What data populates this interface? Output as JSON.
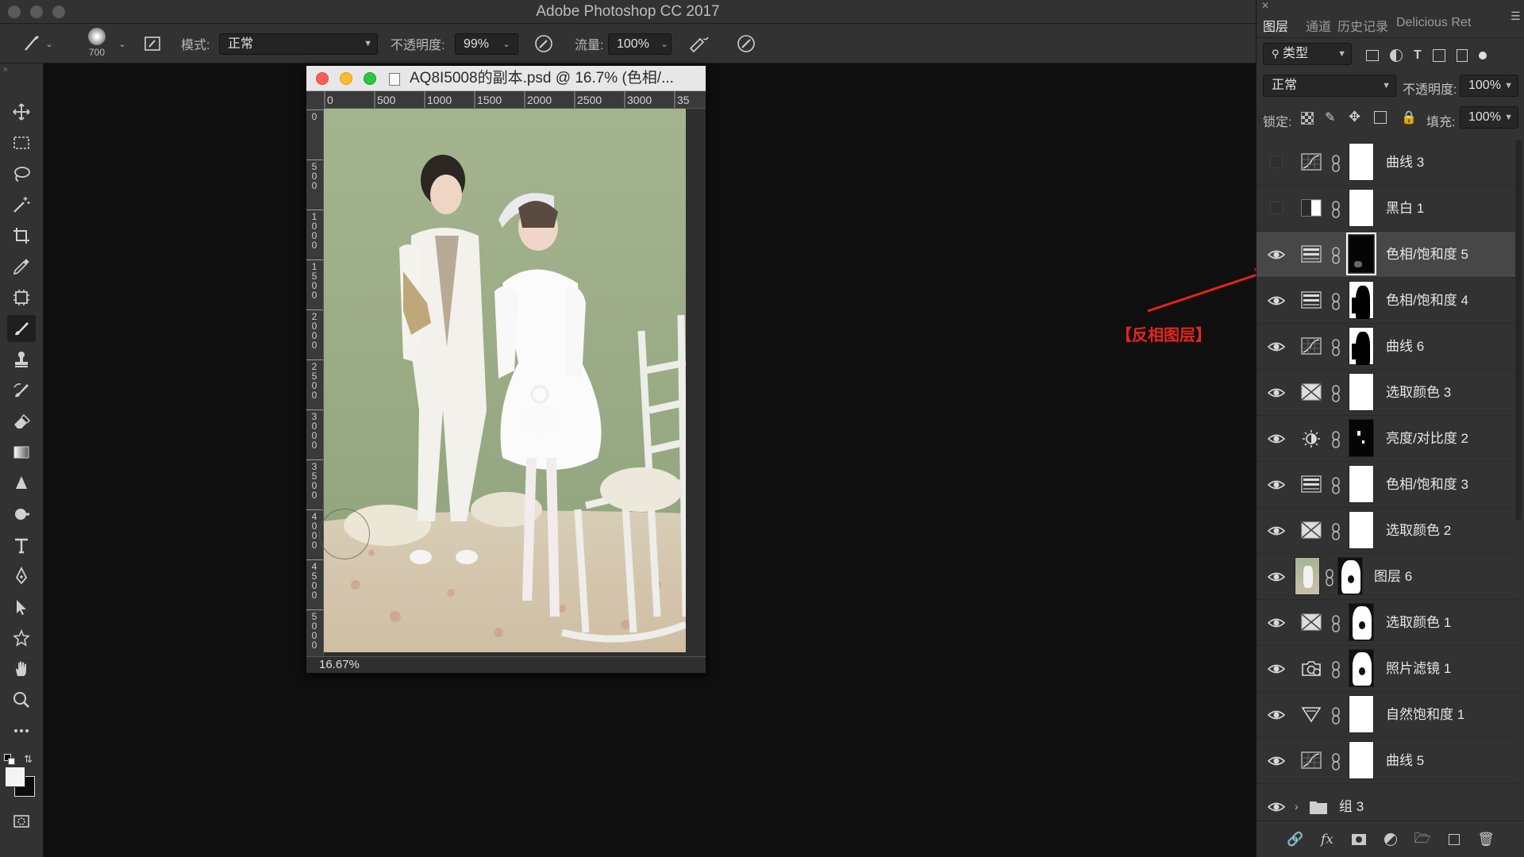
{
  "app": {
    "title": "Adobe Photoshop CC 2017"
  },
  "options_bar": {
    "brush_size": "700",
    "mode_label": "模式:",
    "mode_value": "正常",
    "opacity_label": "不透明度:",
    "opacity_value": "99%",
    "flow_label": "流量:",
    "flow_value": "100%"
  },
  "tools": [
    "move-tool-icon",
    "marquee-tool-icon",
    "lasso-tool-icon",
    "magic-wand-icon",
    "crop-tool-icon",
    "eyedropper-icon",
    "frame-tool-icon",
    "brush-tool-icon",
    "stamp-tool-icon",
    "history-brush-icon",
    "eraser-icon",
    "gradient-icon",
    "blur-tool-icon",
    "dodge-tool-icon",
    "type-tool-icon",
    "pen-tool-icon",
    "path-select-icon",
    "shape-tool-icon",
    "hand-tool-icon",
    "zoom-tool-icon",
    "more-tools-icon"
  ],
  "document": {
    "title": "AQ8I5008的副本.psd @ 16.7% (色相/...",
    "zoom": "16.67%",
    "ruler_h": [
      "0",
      "500",
      "1000",
      "1500",
      "2000",
      "2500",
      "3000",
      "35"
    ],
    "ruler_v": [
      "0",
      "500",
      "1000",
      "1500",
      "2000",
      "2500",
      "3000",
      "3500",
      "4000",
      "4500",
      "5000"
    ]
  },
  "annotation": {
    "text": "【反相图层】",
    "color": "#e8231d"
  },
  "panel": {
    "tabs": [
      "图层",
      "通道",
      "历史记录",
      "Delicious Ret"
    ],
    "filter_value": "类型",
    "blend_value": "正常",
    "opacity_label": "不透明度:",
    "opacity_value": "100%",
    "lock_label": "锁定:",
    "fill_label": "填充:",
    "fill_value": "100%",
    "layers": [
      {
        "name": "曲线 3",
        "visible": false,
        "icon": "curves-icon",
        "mask": "white"
      },
      {
        "name": "黑白 1",
        "visible": false,
        "icon": "black-white-icon",
        "mask": "white"
      },
      {
        "name": "色相/饱和度 5",
        "visible": true,
        "icon": "hue-saturation-icon",
        "mask": "black",
        "selected": true
      },
      {
        "name": "色相/饱和度 4",
        "visible": true,
        "icon": "hue-saturation-icon",
        "mask": "silhouette"
      },
      {
        "name": "曲线 6",
        "visible": true,
        "icon": "curves-icon",
        "mask": "silhouette"
      },
      {
        "name": "选取颜色 3",
        "visible": true,
        "icon": "selective-color-icon",
        "mask": "white"
      },
      {
        "name": "亮度/对比度 2",
        "visible": true,
        "icon": "brightness-contrast-icon",
        "mask": "black-spots"
      },
      {
        "name": "色相/饱和度 3",
        "visible": true,
        "icon": "hue-saturation-icon",
        "mask": "white"
      },
      {
        "name": "选取颜色 2",
        "visible": true,
        "icon": "selective-color-icon",
        "mask": "white"
      },
      {
        "name": "图层 6",
        "visible": true,
        "icon": "pixel-layer-thumbnail",
        "mask": "white-silhouette"
      },
      {
        "name": "选取颜色 1",
        "visible": true,
        "icon": "selective-color-icon",
        "mask": "white-silhouette"
      },
      {
        "name": "照片滤镜 1",
        "visible": true,
        "icon": "photo-filter-icon",
        "mask": "white-silhouette"
      },
      {
        "name": "自然饱和度 1",
        "visible": true,
        "icon": "vibrance-icon",
        "mask": "white"
      },
      {
        "name": "曲线 5",
        "visible": true,
        "icon": "curves-icon",
        "mask": "white"
      },
      {
        "name": "组 3",
        "visible": true,
        "icon": "folder-icon",
        "group": true
      }
    ],
    "footer_icons": [
      "link-icon",
      "fx-icon",
      "mask-icon",
      "adjustment-icon",
      "folder-icon",
      "new-layer-icon",
      "trash-icon"
    ]
  },
  "colors": {
    "accent_annotation": "#e8231d",
    "panel_bg": "#323232",
    "photo_wall": "#9aad85"
  }
}
